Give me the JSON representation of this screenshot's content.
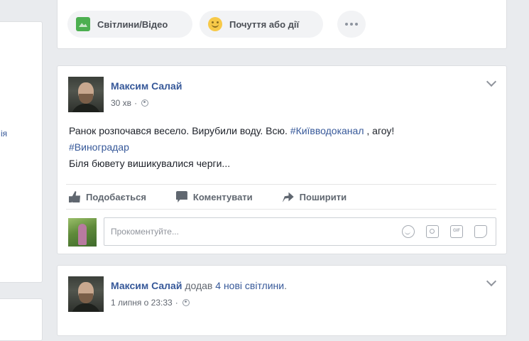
{
  "sidebar": {
    "partial_link": "ія"
  },
  "composer": {
    "photo_video_label": "Світлини/Відео",
    "feeling_label": "Почуття або дії"
  },
  "posts": [
    {
      "author": "Максим Салай",
      "time": "30 хв",
      "text_line1": "Ранок розпочався весело. Вирубили воду. Всю. ",
      "hashtag1": "#Київводоканал",
      "text_after_hashtag1": " , агоу!",
      "hashtag2": "#Виноградар",
      "text_line3": "Біля бювету вишикувалися черги...",
      "actions": {
        "like": "Подобається",
        "comment": "Коментувати",
        "share": "Поширити"
      },
      "comment_placeholder": "Прокоментуйте..."
    },
    {
      "author": "Максим Салай",
      "action_prefix": "додав",
      "action_link": "4 нові світлини",
      "action_suffix": ".",
      "time": "1 липня о 23:33"
    }
  ],
  "icons": {
    "photo": "photo-icon",
    "feeling": "smile-icon",
    "more": "more-dots-icon",
    "privacy": "globe-icon",
    "menu": "chevron-down-icon",
    "like": "thumbs-up-icon",
    "comment": "comment-icon",
    "share": "share-arrow-icon",
    "emoji": "emoji-icon",
    "camera": "camera-icon",
    "gif": "gif-icon",
    "sticker": "sticker-icon"
  },
  "colors": {
    "link": "#365899",
    "background": "#e9ebee",
    "meta": "#616770"
  }
}
